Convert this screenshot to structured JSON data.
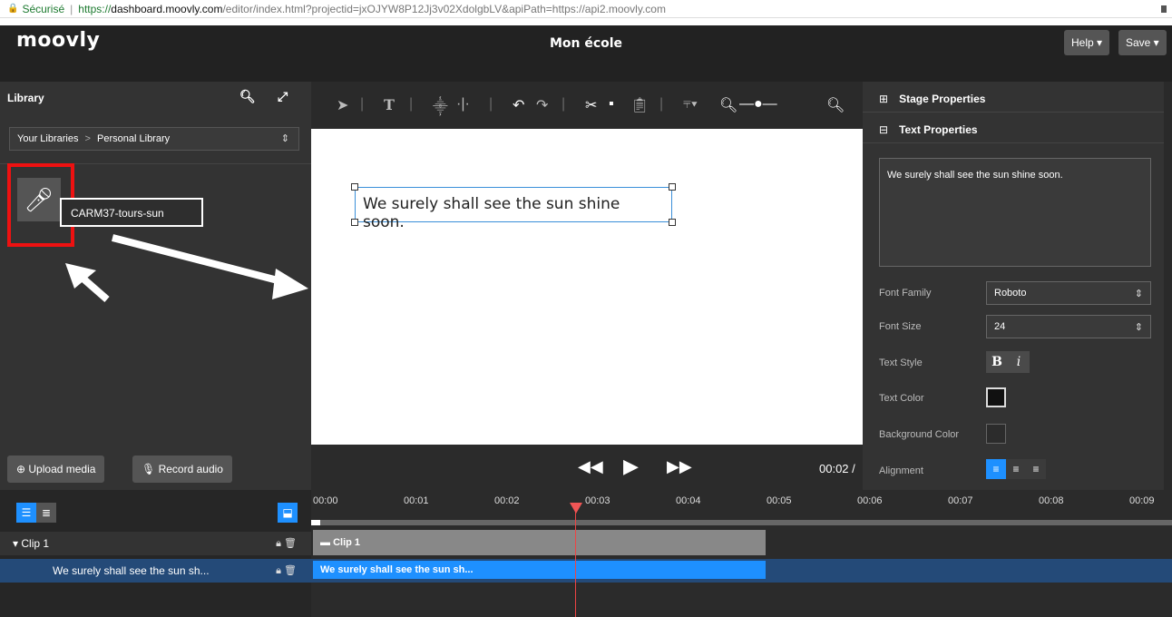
{
  "browser": {
    "security_label": "Sécurisé",
    "url_protocol": "https://",
    "url_host": "dashboard.moovly.com",
    "url_rest": "/editor/index.html?projectid=jxOJYW8P12Jj3v02XdolgbLV&apiPath=https://api2.moovly.com"
  },
  "header": {
    "logo": "moovly",
    "title": "Mon école",
    "help_label": "Help ▾",
    "save_label": "Save ▾"
  },
  "library": {
    "title": "Library",
    "breadcrumb_root": "Your Libraries",
    "breadcrumb_current": "Personal Library",
    "item_name": "CARM37-tours-sun",
    "upload_label": "Upload media",
    "record_label": "Record audio"
  },
  "canvas": {
    "text_content": "We surely shall see the sun shine soon."
  },
  "playback": {
    "time": "00:02 / "
  },
  "properties": {
    "stage_label": "Stage Properties",
    "text_label": "Text Properties",
    "text_value": "We surely shall see the sun shine soon.",
    "font_family_label": "Font Family",
    "font_family_value": "Roboto",
    "font_size_label": "Font Size",
    "font_size_value": "24",
    "text_style_label": "Text Style",
    "bold_glyph": "B",
    "italic_glyph": "i",
    "text_color_label": "Text Color",
    "text_color": "#111111",
    "bg_color_label": "Background Color",
    "alignment_label": "Alignment"
  },
  "timeline": {
    "ticks": [
      "00:00",
      "00:01",
      "00:02",
      "00:03",
      "00:04",
      "00:05",
      "00:06",
      "00:07",
      "00:08",
      "00:09"
    ],
    "clip_row_label": "Clip 1",
    "text_row_label": "We surely shall see the sun sh...",
    "clip_bar_label": "Clip 1",
    "text_bar_label": "We surely shall see the sun sh..."
  }
}
